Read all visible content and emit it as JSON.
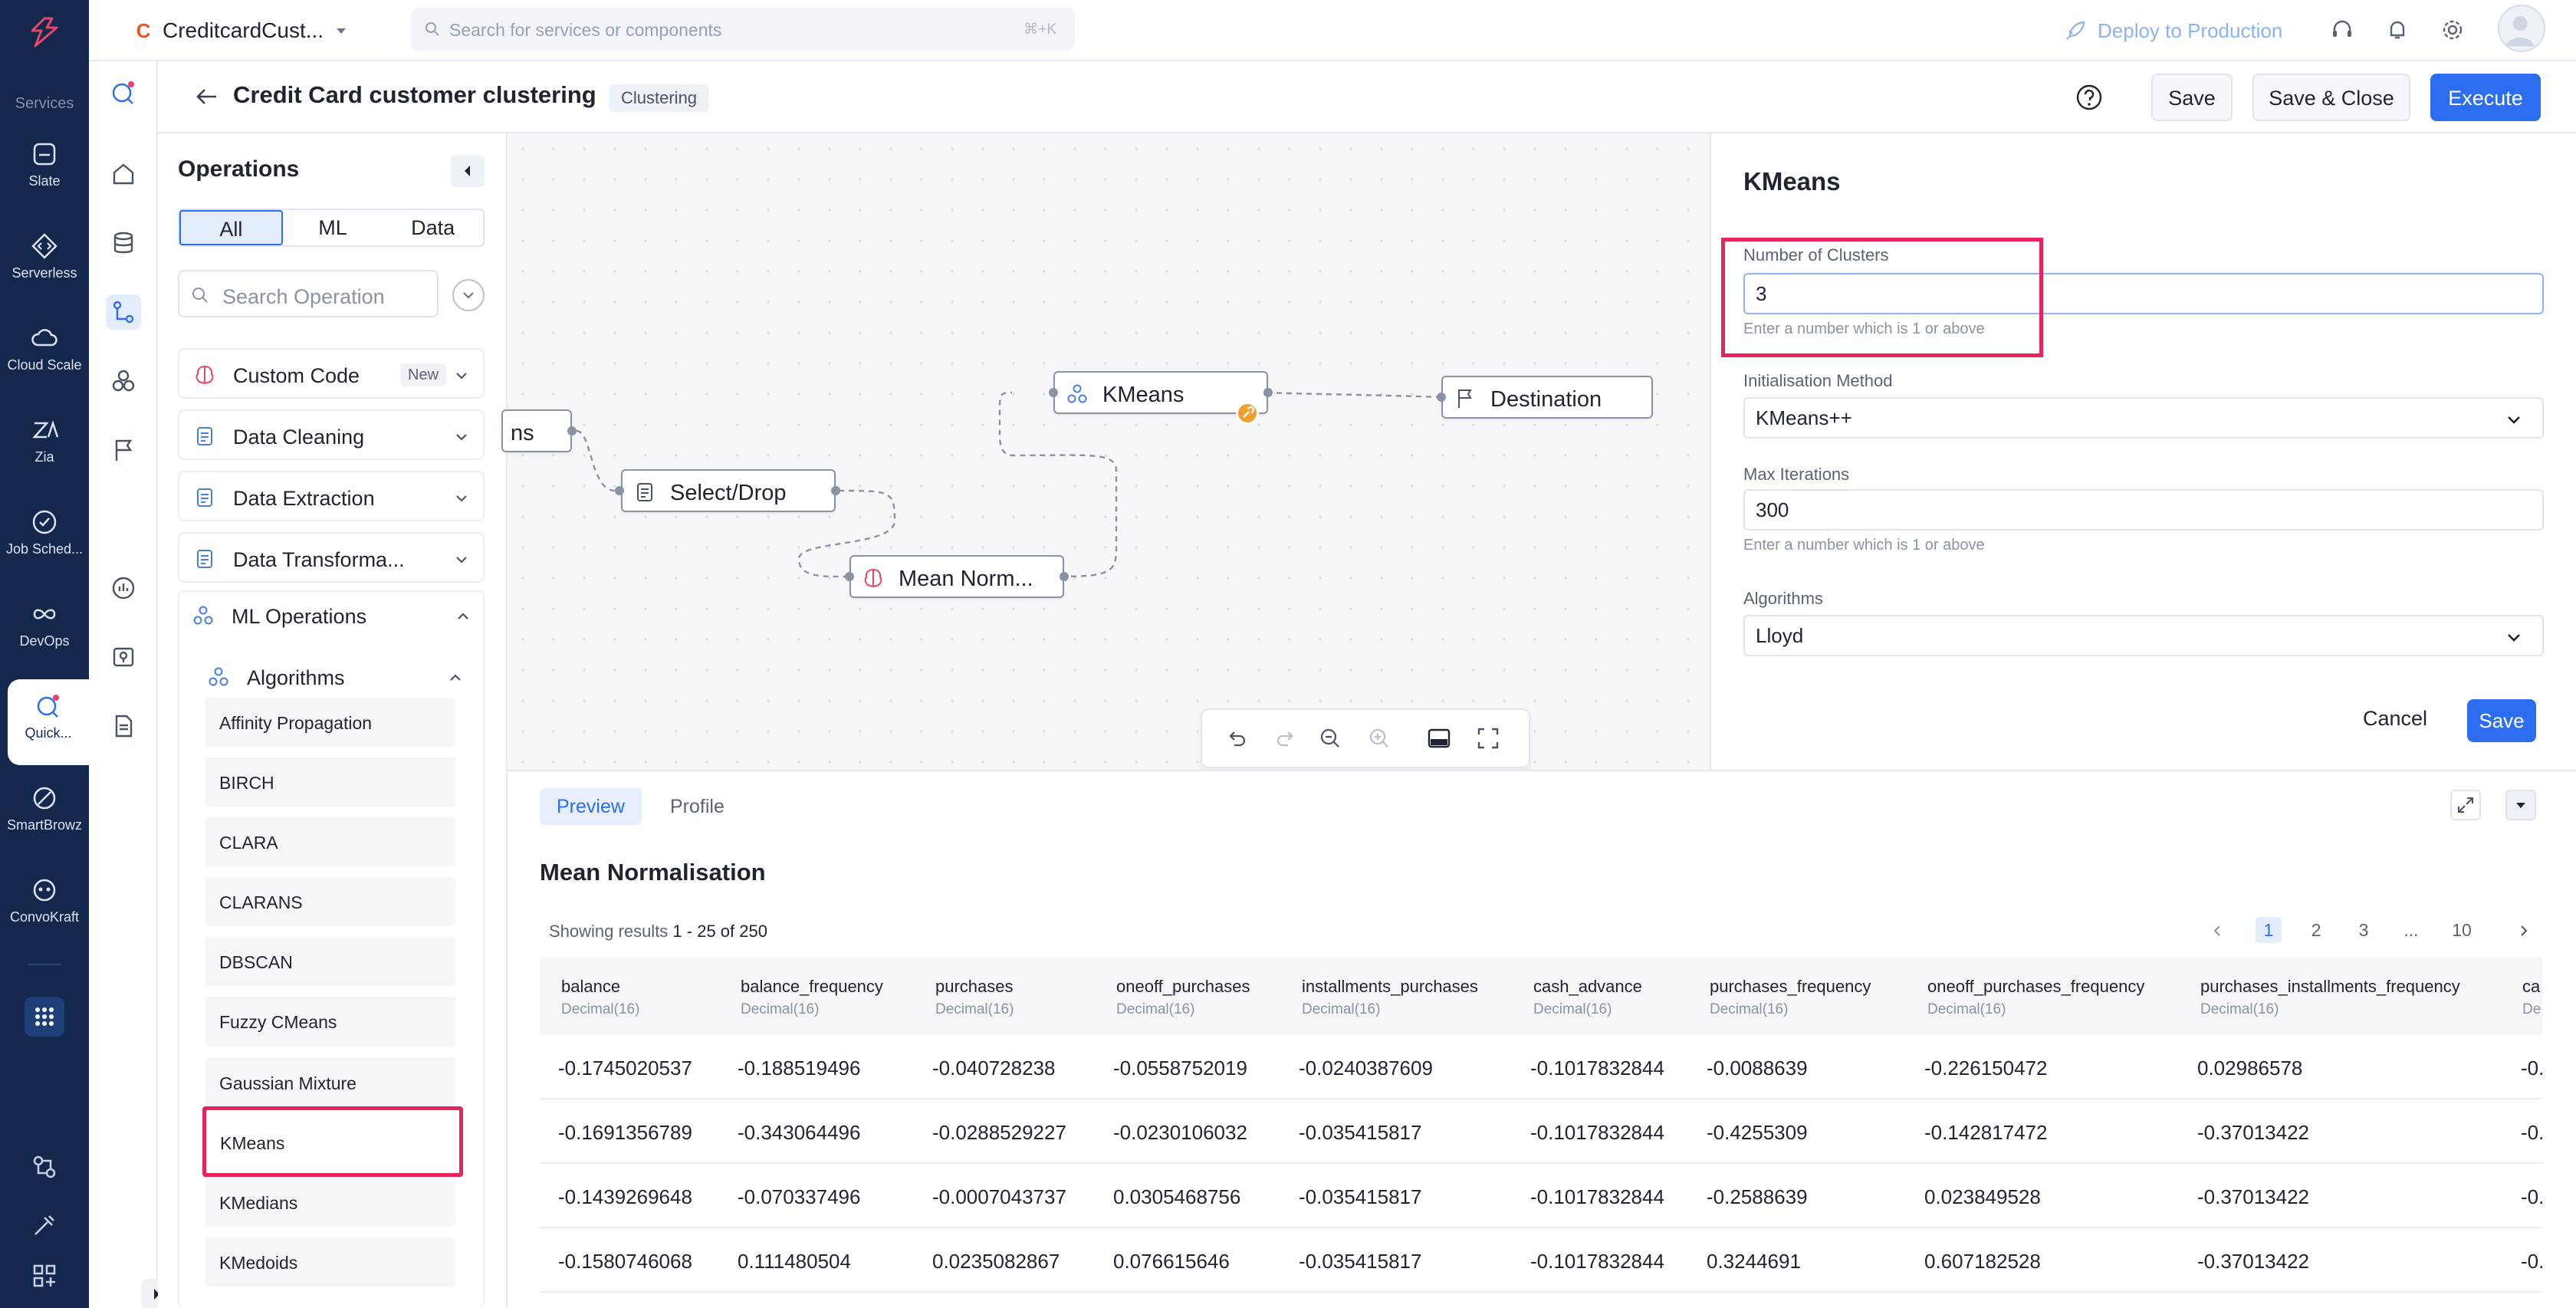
{
  "topbar": {
    "app_initial": "C",
    "app_name": "CreditcardCust...",
    "search_placeholder": "Search for services or components",
    "search_shortcut": "⌘+K",
    "deploy_label": "Deploy to Production"
  },
  "rail": {
    "section_label": "Services",
    "items": [
      {
        "label": "Slate",
        "icon": "slate-icon"
      },
      {
        "label": "Serverless",
        "icon": "code-icon"
      },
      {
        "label": "Cloud Scale",
        "icon": "cloud-icon"
      },
      {
        "label": "Zia",
        "icon": "zia-icon"
      },
      {
        "label": "Job Sched...",
        "icon": "clock-check-icon"
      },
      {
        "label": "DevOps",
        "icon": "infinity-icon"
      },
      {
        "label": "Quick...",
        "icon": "quickml-icon"
      },
      {
        "label": "SmartBrowz",
        "icon": "browser-icon"
      },
      {
        "label": "ConvoKraft",
        "icon": "bot-icon"
      }
    ]
  },
  "header": {
    "title": "Credit Card customer clustering",
    "tag": "Clustering",
    "save_label": "Save",
    "save_close_label": "Save & Close",
    "execute_label": "Execute"
  },
  "operations": {
    "title": "Operations",
    "filters": [
      "All",
      "ML",
      "Data"
    ],
    "active_filter": "All",
    "search_placeholder": "Search Operation",
    "categories": [
      {
        "label": "Custom Code",
        "badge": "New"
      },
      {
        "label": "Data Cleaning"
      },
      {
        "label": "Data Extraction"
      },
      {
        "label": "Data Transforma..."
      },
      {
        "label": "ML Operations"
      }
    ],
    "subcategory": "Algorithms",
    "algorithms": [
      "Affinity Propagation",
      "BIRCH",
      "CLARA",
      "CLARANS",
      "DBSCAN",
      "Fuzzy CMeans",
      "Gaussian Mixture",
      "KMeans",
      "KMedians",
      "KMedoids"
    ],
    "selected_algorithm": "KMeans"
  },
  "canvas": {
    "nodes": {
      "partial": "ns",
      "select_drop": "Select/Drop",
      "mean_norm": "Mean Norm...",
      "kmeans": "KMeans",
      "destination": "Destination"
    }
  },
  "props": {
    "title": "KMeans",
    "clusters_label": "Number of Clusters",
    "clusters_value": "3",
    "clusters_hint": "Enter a number which is 1 or above",
    "init_label": "Initialisation Method",
    "init_value": "KMeans++",
    "iter_label": "Max Iterations",
    "iter_value": "300",
    "iter_hint": "Enter a number which is 1 or above",
    "algo_label": "Algorithms",
    "algo_value": "Lloyd",
    "cancel_label": "Cancel",
    "save_label": "Save"
  },
  "preview": {
    "tabs": [
      "Preview",
      "Profile"
    ],
    "title": "Mean Normalisation",
    "results_prefix": "Showing results ",
    "results_range": "1 - 25 of 250",
    "pages": [
      "1",
      "2",
      "3",
      "...",
      "10"
    ],
    "columns": [
      {
        "name": "balance",
        "type": "Decimal(16)"
      },
      {
        "name": "balance_frequency",
        "type": "Decimal(16)"
      },
      {
        "name": "purchases",
        "type": "Decimal(16)"
      },
      {
        "name": "oneoff_purchases",
        "type": "Decimal(16)"
      },
      {
        "name": "installments_purchases",
        "type": "Decimal(16)"
      },
      {
        "name": "cash_advance",
        "type": "Decimal(16)"
      },
      {
        "name": "purchases_frequency",
        "type": "Decimal(16)"
      },
      {
        "name": "oneoff_purchases_frequency",
        "type": "Decimal(16)"
      },
      {
        "name": "purchases_installments_frequency",
        "type": "Decimal(16)"
      },
      {
        "name": "ca",
        "type": "De"
      }
    ],
    "rows": [
      [
        "-0.1745020537",
        "-0.188519496",
        "-0.040728238",
        "-0.0558752019",
        "-0.0240387609",
        "-0.1017832844",
        "-0.0088639",
        "-0.226150472",
        "0.02986578",
        "-0."
      ],
      [
        "-0.1691356789",
        "-0.343064496",
        "-0.0288529227",
        "-0.0230106032",
        "-0.035415817",
        "-0.1017832844",
        "-0.4255309",
        "-0.142817472",
        "-0.37013422",
        "-0."
      ],
      [
        "-0.1439269648",
        "-0.070337496",
        "-0.0007043737",
        "0.0305468756",
        "-0.035415817",
        "-0.1017832844",
        "-0.2588639",
        "0.023849528",
        "-0.37013422",
        "-0."
      ],
      [
        "-0.1580746068",
        "0.111480504",
        "0.0235082867",
        "0.076615646",
        "-0.035415817",
        "-0.1017832844",
        "0.3244691",
        "0.607182528",
        "-0.37013422",
        "-0."
      ]
    ]
  },
  "colors": {
    "rail_bg": "#14284d",
    "primary": "#2d6ef0",
    "highlight": "#e8245c",
    "warning": "#f0a02c"
  }
}
